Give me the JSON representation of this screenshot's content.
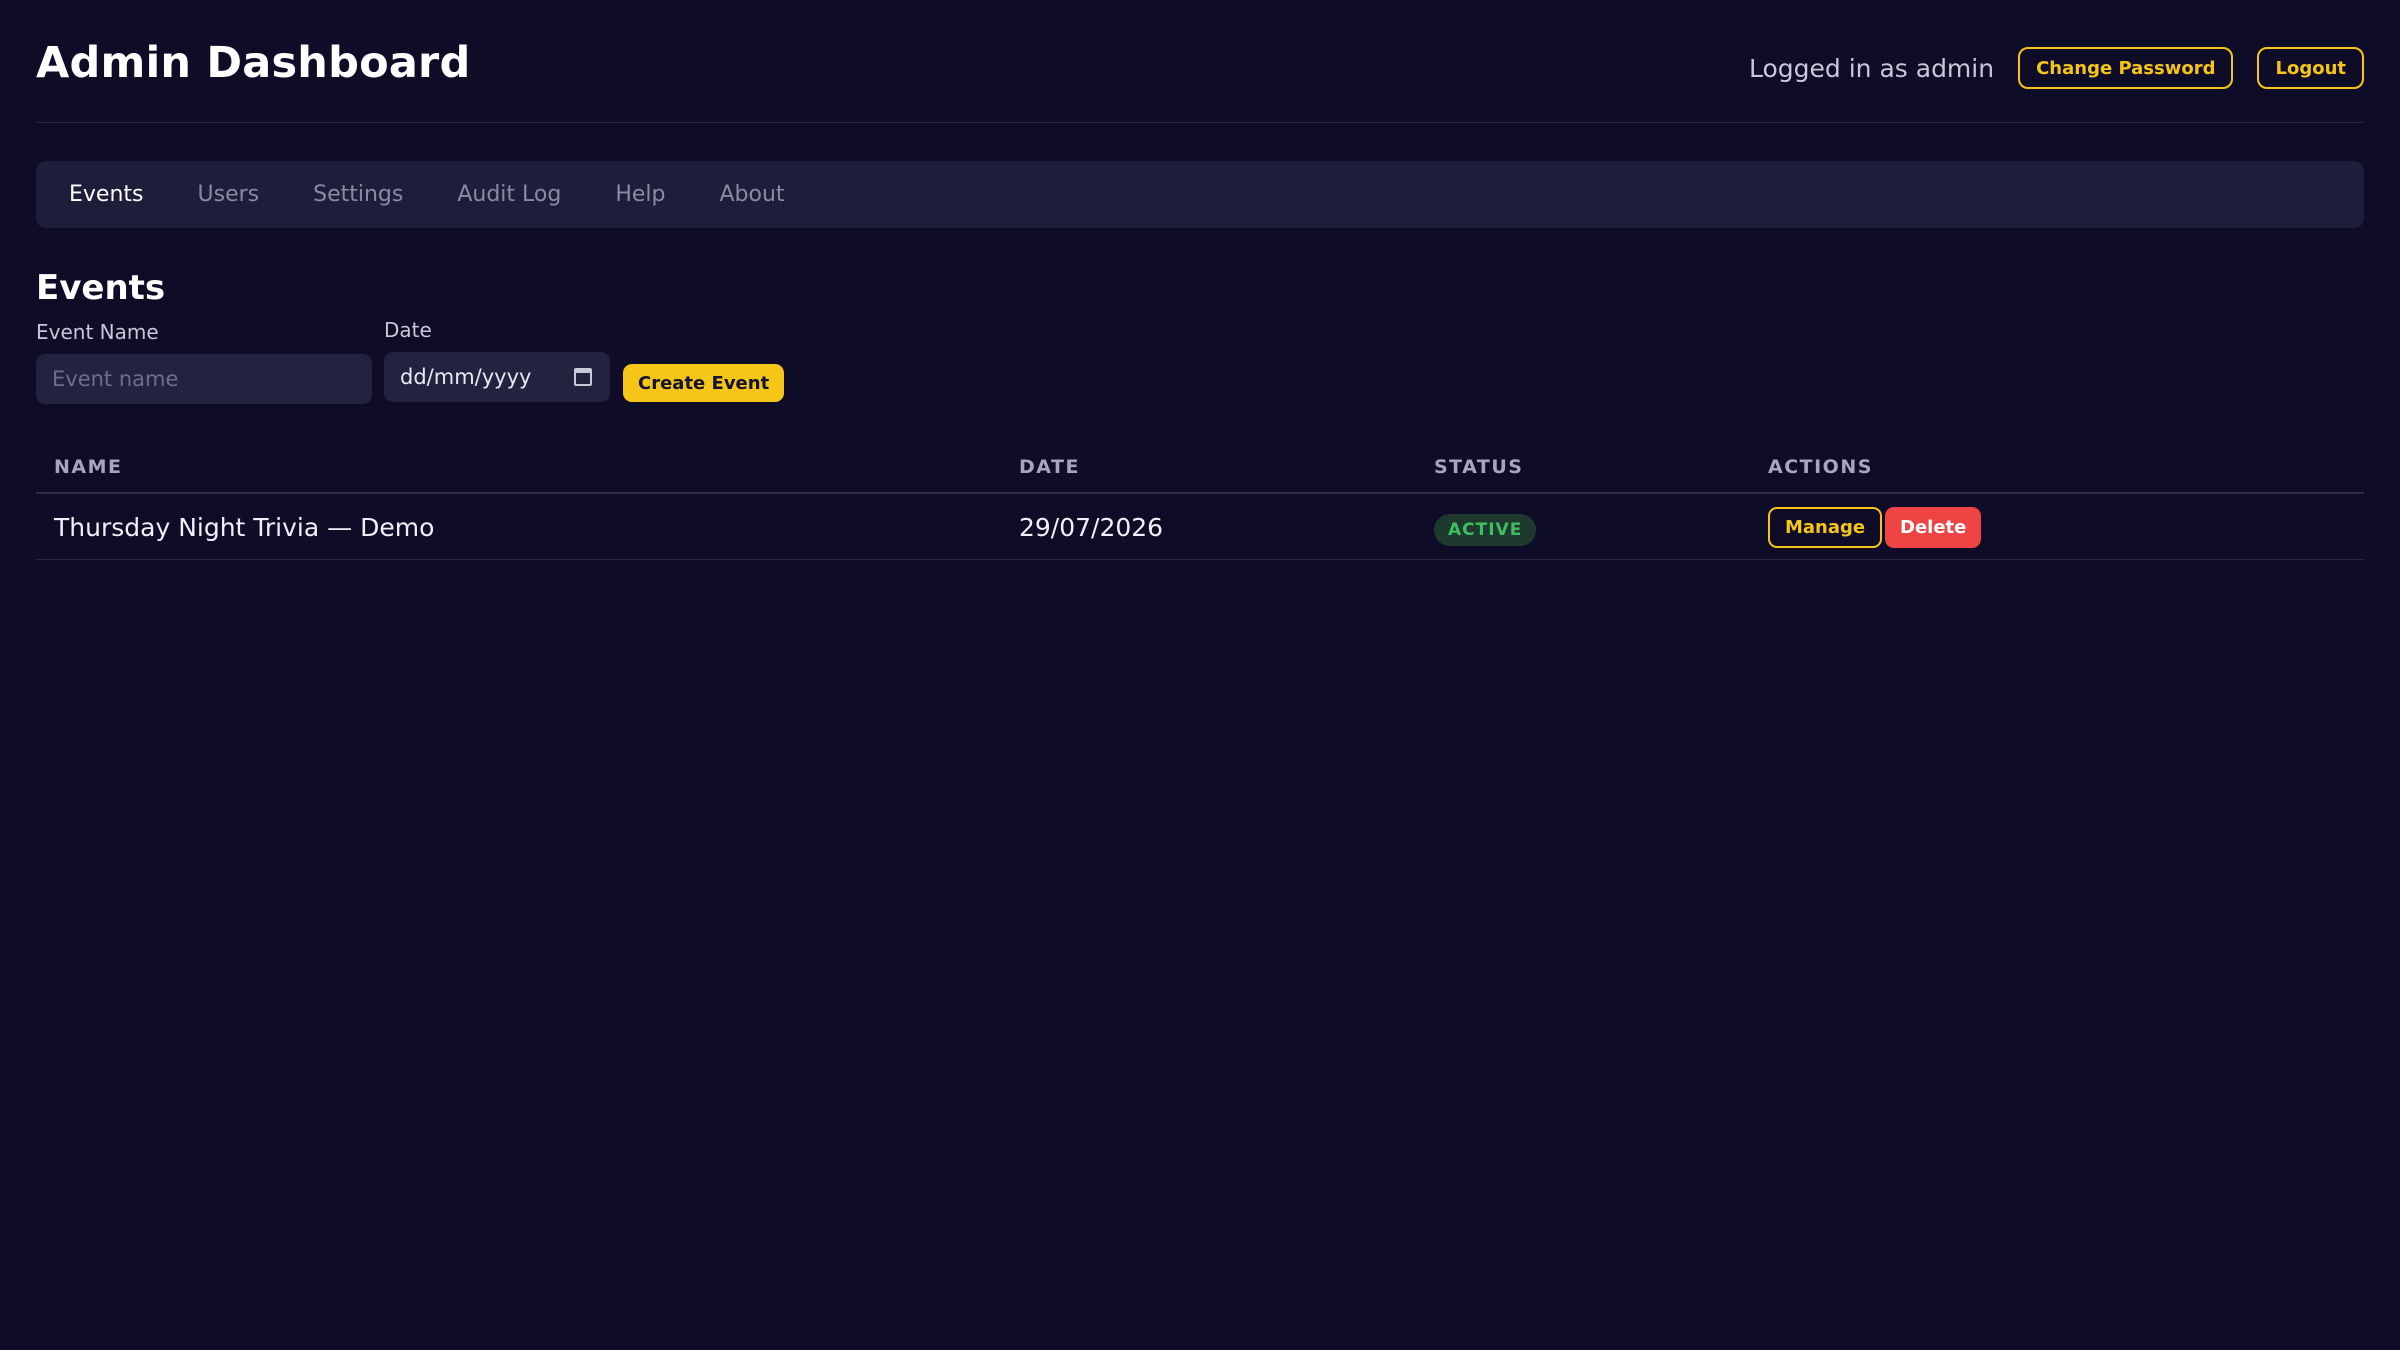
{
  "header": {
    "title": "Admin Dashboard",
    "logged_in_text": "Logged in as admin",
    "change_password_label": "Change Password",
    "logout_label": "Logout"
  },
  "tabs": [
    {
      "label": "Events",
      "active": true
    },
    {
      "label": "Users",
      "active": false
    },
    {
      "label": "Settings",
      "active": false
    },
    {
      "label": "Audit Log",
      "active": false
    },
    {
      "label": "Help",
      "active": false
    },
    {
      "label": "About",
      "active": false
    }
  ],
  "events_section": {
    "title": "Events",
    "form": {
      "event_name_label": "Event Name",
      "event_name_placeholder": "Event name",
      "event_name_value": "",
      "date_label": "Date",
      "date_placeholder": "dd/mm/yyyy",
      "create_button_label": "Create Event"
    },
    "table": {
      "columns": [
        "NAME",
        "DATE",
        "STATUS",
        "ACTIONS"
      ],
      "rows": [
        {
          "name": "Thursday Night Trivia — Demo",
          "date": "29/07/2026",
          "status": "ACTIVE",
          "manage_label": "Manage",
          "delete_label": "Delete"
        }
      ]
    }
  },
  "colors": {
    "background": "#0e0c27",
    "accent_yellow": "#f5c518",
    "danger_red": "#ef4444",
    "status_green": "#3fbf5f"
  },
  "icons": {
    "date_picker": "calendar-icon"
  }
}
